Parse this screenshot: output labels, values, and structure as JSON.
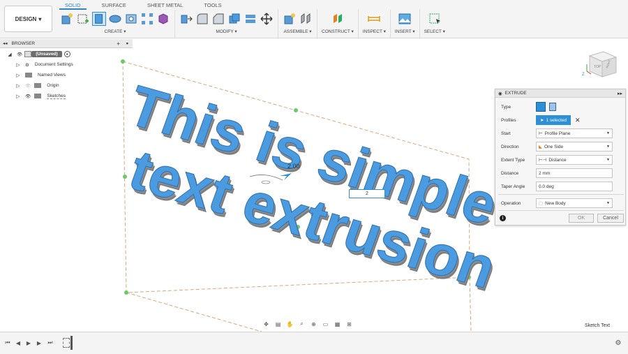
{
  "workspace": {
    "design_label": "DESIGN"
  },
  "tabs": [
    {
      "label": "SOLID",
      "active": true
    },
    {
      "label": "SURFACE",
      "active": false
    },
    {
      "label": "SHEET METAL",
      "active": false
    },
    {
      "label": "TOOLS",
      "active": false
    }
  ],
  "tool_groups": {
    "create": "CREATE",
    "modify": "MODIFY",
    "assemble": "ASSEMBLE",
    "construct": "CONSTRUCT",
    "inspect": "INSPECT",
    "insert": "INSERT",
    "select": "SELECT"
  },
  "browser": {
    "title": "BROWSER",
    "root": "(Unsaved)",
    "items": [
      "Document Settings",
      "Named Views",
      "Origin",
      "Sketches"
    ]
  },
  "canvas": {
    "line1": "This is simple",
    "line2": "text extrusion",
    "dimension_label": "2.00",
    "dimension_input": "2"
  },
  "extrude": {
    "title": "EXTRUDE",
    "type_label": "Type",
    "profiles_label": "Profiles",
    "profiles_value": "1 selected",
    "start_label": "Start",
    "start_value": "Profile Plane",
    "direction_label": "Direction",
    "direction_value": "One Side",
    "extent_label": "Extent Type",
    "extent_value": "Distance",
    "distance_label": "Distance",
    "distance_value": "2 mm",
    "taper_label": "Taper Angle",
    "taper_value": "0.0 deg",
    "operation_label": "Operation",
    "operation_value": "New Body",
    "ok_label": "OK",
    "cancel_label": "Cancel"
  },
  "viewcube": {
    "top": "TOP",
    "right": "RIGHT"
  },
  "status_text": "Sketch Text",
  "colors": {
    "accent": "#2d8fd5",
    "extrude_face": "#4a9be0",
    "extrude_side": "#8a8a8a"
  }
}
